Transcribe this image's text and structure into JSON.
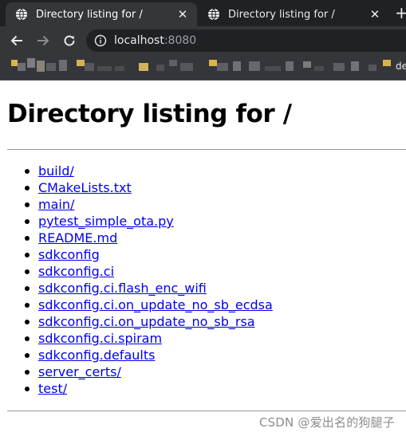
{
  "browser": {
    "tabs": [
      {
        "title": "Directory listing for /",
        "active": true
      },
      {
        "title": "Directory listing for /",
        "active": false
      }
    ],
    "tab_close_glyph": "✕",
    "new_tab_glyph": "+",
    "address": {
      "host": "localhost",
      "port": ":8080"
    },
    "bookmarks_trailing": "de"
  },
  "page": {
    "heading": "Directory listing for /",
    "items": [
      "build/",
      "CMakeLists.txt",
      "main/",
      "pytest_simple_ota.py",
      "README.md",
      "sdkconfig",
      "sdkconfig.ci",
      "sdkconfig.ci.flash_enc_wifi",
      "sdkconfig.ci.on_update_no_sb_ecdsa",
      "sdkconfig.ci.on_update_no_sb_rsa",
      "sdkconfig.ci.spiram",
      "sdkconfig.defaults",
      "server_certs/",
      "test/"
    ]
  },
  "watermark": "CSDN @爱出名的狗腿子",
  "icons": {
    "favicon": "globe-icon",
    "back": "arrow-left-icon",
    "forward": "arrow-right-icon",
    "reload": "reload-icon",
    "site_info": "info-icon"
  },
  "colors": {
    "link": "#0000ee",
    "chrome_dark": "#202124",
    "chrome_toolbar": "#35363a"
  }
}
